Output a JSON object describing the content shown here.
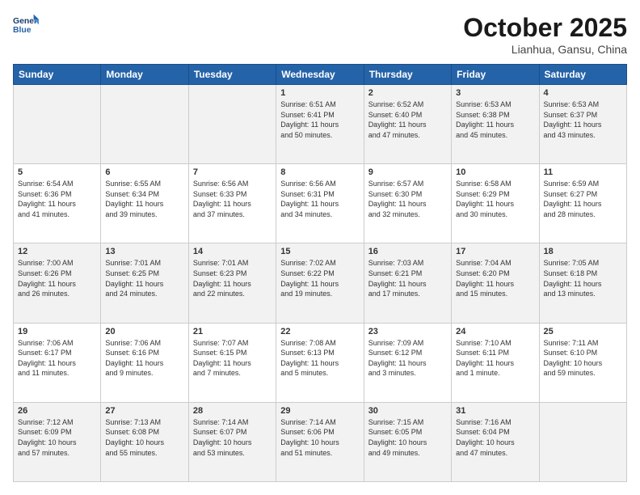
{
  "logo": {
    "line1": "General",
    "line2": "Blue"
  },
  "title": "October 2025",
  "location": "Lianhua, Gansu, China",
  "weekdays": [
    "Sunday",
    "Monday",
    "Tuesday",
    "Wednesday",
    "Thursday",
    "Friday",
    "Saturday"
  ],
  "weeks": [
    [
      {
        "day": "",
        "info": ""
      },
      {
        "day": "",
        "info": ""
      },
      {
        "day": "",
        "info": ""
      },
      {
        "day": "1",
        "info": "Sunrise: 6:51 AM\nSunset: 6:41 PM\nDaylight: 11 hours\nand 50 minutes."
      },
      {
        "day": "2",
        "info": "Sunrise: 6:52 AM\nSunset: 6:40 PM\nDaylight: 11 hours\nand 47 minutes."
      },
      {
        "day": "3",
        "info": "Sunrise: 6:53 AM\nSunset: 6:38 PM\nDaylight: 11 hours\nand 45 minutes."
      },
      {
        "day": "4",
        "info": "Sunrise: 6:53 AM\nSunset: 6:37 PM\nDaylight: 11 hours\nand 43 minutes."
      }
    ],
    [
      {
        "day": "5",
        "info": "Sunrise: 6:54 AM\nSunset: 6:36 PM\nDaylight: 11 hours\nand 41 minutes."
      },
      {
        "day": "6",
        "info": "Sunrise: 6:55 AM\nSunset: 6:34 PM\nDaylight: 11 hours\nand 39 minutes."
      },
      {
        "day": "7",
        "info": "Sunrise: 6:56 AM\nSunset: 6:33 PM\nDaylight: 11 hours\nand 37 minutes."
      },
      {
        "day": "8",
        "info": "Sunrise: 6:56 AM\nSunset: 6:31 PM\nDaylight: 11 hours\nand 34 minutes."
      },
      {
        "day": "9",
        "info": "Sunrise: 6:57 AM\nSunset: 6:30 PM\nDaylight: 11 hours\nand 32 minutes."
      },
      {
        "day": "10",
        "info": "Sunrise: 6:58 AM\nSunset: 6:29 PM\nDaylight: 11 hours\nand 30 minutes."
      },
      {
        "day": "11",
        "info": "Sunrise: 6:59 AM\nSunset: 6:27 PM\nDaylight: 11 hours\nand 28 minutes."
      }
    ],
    [
      {
        "day": "12",
        "info": "Sunrise: 7:00 AM\nSunset: 6:26 PM\nDaylight: 11 hours\nand 26 minutes."
      },
      {
        "day": "13",
        "info": "Sunrise: 7:01 AM\nSunset: 6:25 PM\nDaylight: 11 hours\nand 24 minutes."
      },
      {
        "day": "14",
        "info": "Sunrise: 7:01 AM\nSunset: 6:23 PM\nDaylight: 11 hours\nand 22 minutes."
      },
      {
        "day": "15",
        "info": "Sunrise: 7:02 AM\nSunset: 6:22 PM\nDaylight: 11 hours\nand 19 minutes."
      },
      {
        "day": "16",
        "info": "Sunrise: 7:03 AM\nSunset: 6:21 PM\nDaylight: 11 hours\nand 17 minutes."
      },
      {
        "day": "17",
        "info": "Sunrise: 7:04 AM\nSunset: 6:20 PM\nDaylight: 11 hours\nand 15 minutes."
      },
      {
        "day": "18",
        "info": "Sunrise: 7:05 AM\nSunset: 6:18 PM\nDaylight: 11 hours\nand 13 minutes."
      }
    ],
    [
      {
        "day": "19",
        "info": "Sunrise: 7:06 AM\nSunset: 6:17 PM\nDaylight: 11 hours\nand 11 minutes."
      },
      {
        "day": "20",
        "info": "Sunrise: 7:06 AM\nSunset: 6:16 PM\nDaylight: 11 hours\nand 9 minutes."
      },
      {
        "day": "21",
        "info": "Sunrise: 7:07 AM\nSunset: 6:15 PM\nDaylight: 11 hours\nand 7 minutes."
      },
      {
        "day": "22",
        "info": "Sunrise: 7:08 AM\nSunset: 6:13 PM\nDaylight: 11 hours\nand 5 minutes."
      },
      {
        "day": "23",
        "info": "Sunrise: 7:09 AM\nSunset: 6:12 PM\nDaylight: 11 hours\nand 3 minutes."
      },
      {
        "day": "24",
        "info": "Sunrise: 7:10 AM\nSunset: 6:11 PM\nDaylight: 11 hours\nand 1 minute."
      },
      {
        "day": "25",
        "info": "Sunrise: 7:11 AM\nSunset: 6:10 PM\nDaylight: 10 hours\nand 59 minutes."
      }
    ],
    [
      {
        "day": "26",
        "info": "Sunrise: 7:12 AM\nSunset: 6:09 PM\nDaylight: 10 hours\nand 57 minutes."
      },
      {
        "day": "27",
        "info": "Sunrise: 7:13 AM\nSunset: 6:08 PM\nDaylight: 10 hours\nand 55 minutes."
      },
      {
        "day": "28",
        "info": "Sunrise: 7:14 AM\nSunset: 6:07 PM\nDaylight: 10 hours\nand 53 minutes."
      },
      {
        "day": "29",
        "info": "Sunrise: 7:14 AM\nSunset: 6:06 PM\nDaylight: 10 hours\nand 51 minutes."
      },
      {
        "day": "30",
        "info": "Sunrise: 7:15 AM\nSunset: 6:05 PM\nDaylight: 10 hours\nand 49 minutes."
      },
      {
        "day": "31",
        "info": "Sunrise: 7:16 AM\nSunset: 6:04 PM\nDaylight: 10 hours\nand 47 minutes."
      },
      {
        "day": "",
        "info": ""
      }
    ]
  ]
}
